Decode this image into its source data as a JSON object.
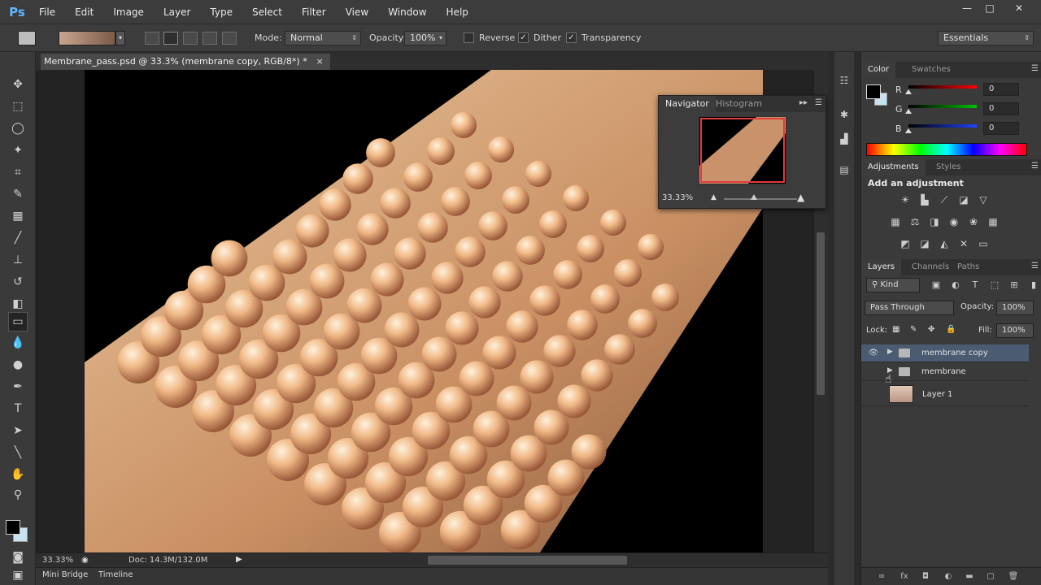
{
  "app": {
    "logo": "Ps"
  },
  "menu": [
    "File",
    "Edit",
    "Image",
    "Layer",
    "Type",
    "Select",
    "Filter",
    "View",
    "Window",
    "Help"
  ],
  "window_controls": {
    "minimize": "—",
    "maximize": "□",
    "close": "✕"
  },
  "options": {
    "mode_label": "Mode:",
    "mode_value": "Normal",
    "opacity_label": "Opacity:",
    "opacity_value": "100%",
    "reverse_label": "Reverse",
    "dither_label": "Dither",
    "transparency_label": "Transparency",
    "workspace_value": "Essentials"
  },
  "document": {
    "tab_title": "Membrane_pass.psd @ 33.3% (membrane copy, RGB/8*) *",
    "close": "×"
  },
  "status": {
    "zoom": "33.33%",
    "doc": "Doc: 14.3M/132.0M"
  },
  "bottom_tabs": [
    "Mini Bridge",
    "Timeline"
  ],
  "navigator": {
    "tabs": [
      "Navigator",
      "Histogram"
    ],
    "zoom": "33.33%"
  },
  "color_panel": {
    "tabs": [
      "Color",
      "Swatches"
    ],
    "r_label": "R",
    "g_label": "G",
    "b_label": "B",
    "r": "0",
    "g": "0",
    "b": "0"
  },
  "adjustments": {
    "tabs": [
      "Adjustments",
      "Styles"
    ],
    "title": "Add an adjustment"
  },
  "layers_panel": {
    "tabs": [
      "Layers",
      "Channels",
      "Paths"
    ],
    "kind": "Kind",
    "blend_mode": "Pass Through",
    "opacity_label": "Opacity:",
    "opacity": "100%",
    "lock_label": "Lock:",
    "fill_label": "Fill:",
    "fill": "100%",
    "layers": [
      {
        "name": "membrane copy",
        "type": "group",
        "visible": true,
        "selected": true
      },
      {
        "name": "membrane",
        "type": "group",
        "visible": false,
        "selected": false
      },
      {
        "name": "Layer 1",
        "type": "pixel",
        "visible": false,
        "selected": false
      }
    ]
  },
  "colors": {
    "accent_selected_layer": "#4a5b72",
    "panel_bg": "#3a3a3a",
    "ps_blue": "#5fb7ff"
  }
}
